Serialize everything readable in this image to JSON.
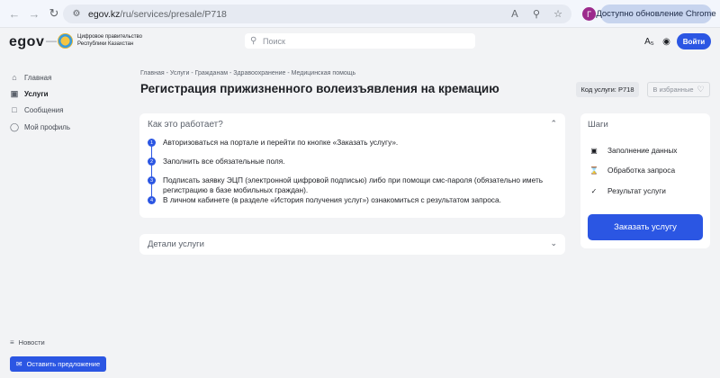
{
  "browser": {
    "back_icon": "arrow-left-icon",
    "forward_icon": "arrow-right-icon",
    "reload_icon": "reload-icon",
    "url_host": "egov.kz",
    "url_path": "/ru/services/presale/P718",
    "profile_letter": "Г",
    "update_label": "Доступно обновление Chrome"
  },
  "header": {
    "logo": "egov",
    "gov_name": "Цифровое правительство Республики Казахстан",
    "search_placeholder": "Поиск"
  },
  "sidebar": {
    "items": [
      {
        "label": "Главная",
        "icon": "home-icon"
      },
      {
        "label": "Услуги",
        "icon": "services-icon"
      },
      {
        "label": "Сообщения",
        "icon": "messages-icon"
      },
      {
        "label": "Мой профиль",
        "icon": "profile-icon"
      }
    ],
    "news_label": "Новости",
    "suggest_label": "Оставить предложение"
  },
  "main": {
    "breadcrumb": "Главная - Услуги - Гражданам - Здравоохранение - Медицинская помощь",
    "title": "Регистрация прижизненного волеизъявления на кремацию",
    "code_badge": "Код услуги: P718",
    "favorite_label": "В избранные",
    "how_title": "Как это работает?",
    "steps": [
      {
        "num": "1",
        "text": "Авторизоваться на портале и перейти по кнопке «Заказать услугу»."
      },
      {
        "num": "2",
        "text": "Заполнить все обязательные поля."
      },
      {
        "num": "3",
        "text": "Подписать заявку ЭЦП (электронной цифровой подписью) либо при помощи смс-пароля (обязательно иметь регистрацию в базе мобильных граждан)."
      },
      {
        "num": "4",
        "text": "В личном кабинете (в разделе «История получения услуг») ознакомиться с результатом запроса."
      }
    ],
    "details_title": "Детали услуги"
  },
  "steps_panel": {
    "title": "Шаги",
    "stages": [
      {
        "label": "Заполнение данных",
        "icon": "form-icon"
      },
      {
        "label": "Обработка запроса",
        "icon": "hourglass-icon"
      },
      {
        "label": "Результат услуги",
        "icon": "check-icon"
      }
    ],
    "order_label": "Заказать услугу"
  },
  "colors": {
    "accent": "#2b56e3",
    "background": "#f2f3f5",
    "card": "#ffffff"
  }
}
